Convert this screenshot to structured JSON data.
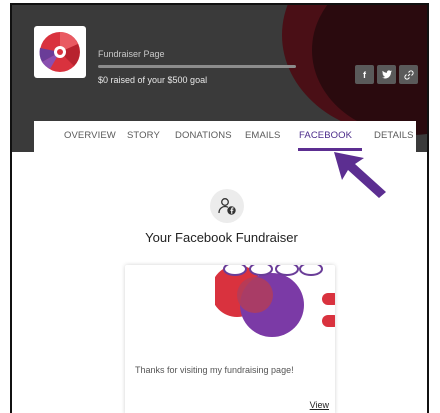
{
  "campaign": {
    "title": "Fundraiser Page",
    "raised_text": "$0 raised of your $500 goal",
    "progress_percent": 0
  },
  "share": {
    "facebook_icon": "f",
    "twitter_icon": "twitter-bird",
    "link_icon": "link"
  },
  "tabs": [
    {
      "label": "OVERVIEW",
      "active": false
    },
    {
      "label": "STORY",
      "active": false
    },
    {
      "label": "DONATIONS",
      "active": false
    },
    {
      "label": "EMAILS",
      "active": false
    },
    {
      "label": "FACEBOOK",
      "active": true
    },
    {
      "label": "DETAILS",
      "active": false
    }
  ],
  "facebook_section": {
    "icon": "user-facebook-icon",
    "heading": "Your Facebook Fundraiser",
    "card_message": "Thanks for visiting my fundraising page!",
    "card_link": "View"
  },
  "colors": {
    "header_bg": "#3a3a3a",
    "accent_purple": "#5c2e91",
    "pointer_arrow": "#5c2e91"
  }
}
